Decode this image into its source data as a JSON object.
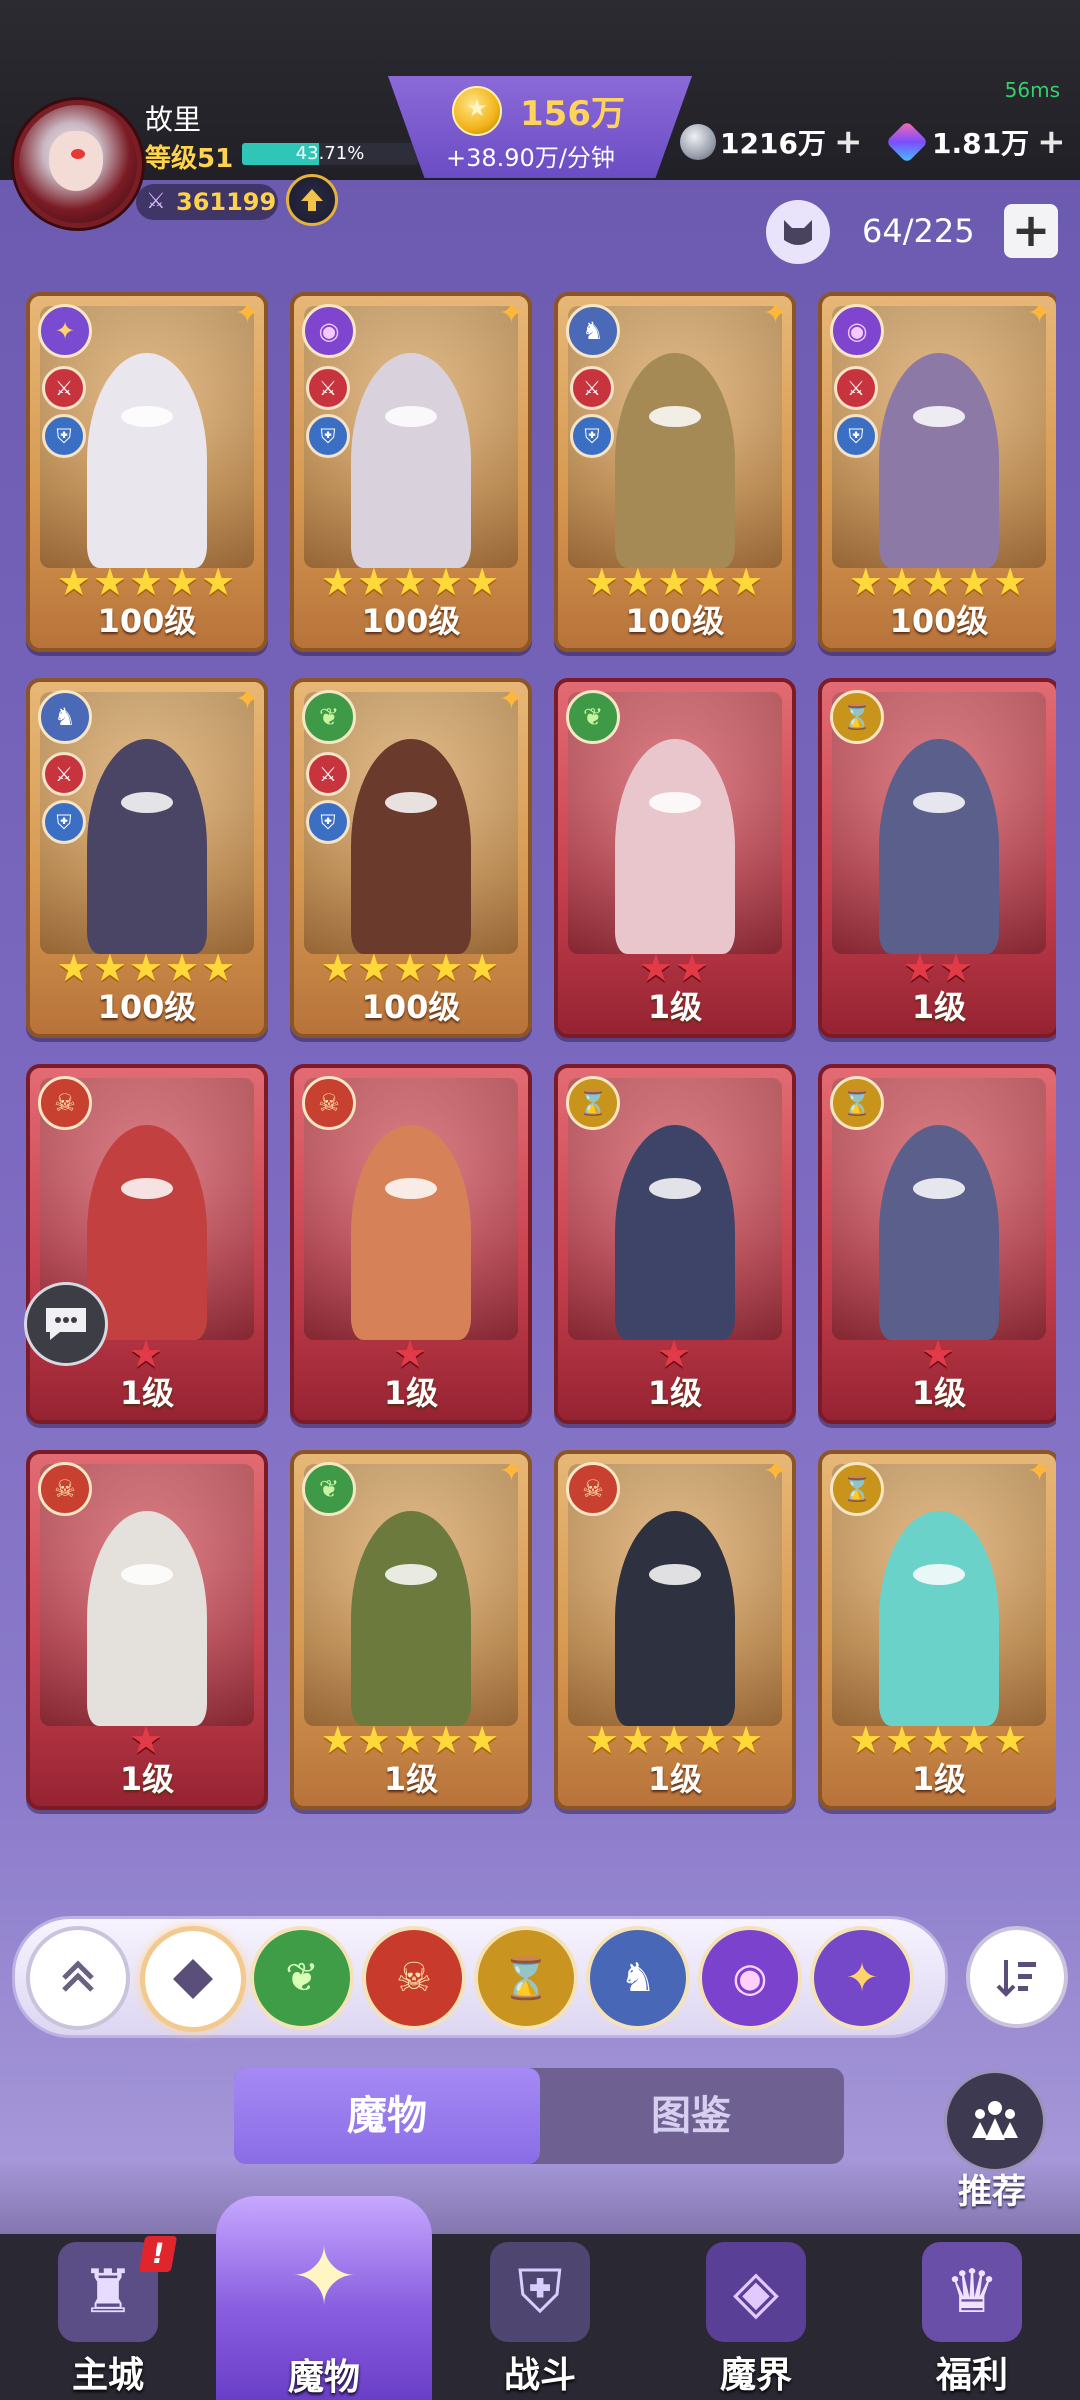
{
  "status": {
    "ping": "56ms"
  },
  "player": {
    "name": "故里",
    "level": "等级51",
    "xp_percent": "43.71%",
    "xp_fraction": 0.4371,
    "power": "361199"
  },
  "gold": {
    "amount": "156万",
    "rate": "+38.90万/分钟"
  },
  "currencies": [
    {
      "icon": "silver-coin-icon",
      "value": "1216万"
    },
    {
      "icon": "gem-icon",
      "value": "1.81万"
    }
  ],
  "collection": {
    "count": "64/225"
  },
  "monsters": [
    {
      "frame": "gold",
      "element": "spirit",
      "roles": true,
      "stars": 5,
      "star_color": "gold",
      "level": "100级",
      "art": "#e9e6ee"
    },
    {
      "frame": "gold",
      "element": "eye",
      "roles": true,
      "stars": 5,
      "star_color": "gold",
      "level": "100级",
      "art": "#d9d2dc"
    },
    {
      "frame": "gold",
      "element": "dragon",
      "roles": true,
      "stars": 5,
      "star_color": "gold",
      "level": "100级",
      "art": "#a58a56"
    },
    {
      "frame": "gold",
      "element": "eye",
      "roles": true,
      "stars": 5,
      "star_color": "gold",
      "level": "100级",
      "art": "#8d79a6"
    },
    {
      "frame": "gold",
      "element": "dragon",
      "roles": true,
      "stars": 5,
      "star_color": "gold",
      "level": "100级",
      "art": "#4b4565"
    },
    {
      "frame": "gold",
      "element": "nature",
      "roles": true,
      "stars": 5,
      "star_color": "gold",
      "level": "100级",
      "art": "#6a3a2d"
    },
    {
      "frame": "red",
      "element": "nature",
      "roles": false,
      "stars": 2,
      "star_color": "red",
      "level": "1级",
      "art": "#e9c6cc"
    },
    {
      "frame": "red",
      "element": "time",
      "roles": false,
      "stars": 2,
      "star_color": "red",
      "level": "1级",
      "art": "#5a5f8c"
    },
    {
      "frame": "red",
      "element": "demon",
      "roles": false,
      "stars": 1,
      "star_color": "red",
      "level": "1级",
      "art": "#c2403f"
    },
    {
      "frame": "red",
      "element": "demon",
      "roles": false,
      "stars": 1,
      "star_color": "red",
      "level": "1级",
      "art": "#d78158"
    },
    {
      "frame": "red",
      "element": "time",
      "roles": false,
      "stars": 1,
      "star_color": "red",
      "level": "1级",
      "art": "#3e4468"
    },
    {
      "frame": "red",
      "element": "time",
      "roles": false,
      "stars": 1,
      "star_color": "red",
      "level": "1级",
      "art": "#5a5f8c"
    },
    {
      "frame": "red",
      "element": "demon",
      "roles": false,
      "stars": 1,
      "star_color": "red",
      "level": "1级",
      "art": "#e4e0dc"
    },
    {
      "frame": "gold",
      "element": "nature",
      "roles": false,
      "stars": 5,
      "star_color": "gold",
      "level": "1级",
      "art": "#6c7a3e"
    },
    {
      "frame": "gold",
      "element": "demon",
      "roles": false,
      "stars": 5,
      "star_color": "gold",
      "level": "1级",
      "art": "#2e3140"
    },
    {
      "frame": "gold",
      "element": "time",
      "roles": false,
      "stars": 5,
      "star_color": "gold",
      "level": "1级",
      "art": "#6ad2c8"
    }
  ],
  "filters": [
    "all",
    "nature",
    "demon",
    "time",
    "dragon",
    "eye",
    "spirit"
  ],
  "tabs": {
    "active": "魔物",
    "inactive": "图鉴"
  },
  "recommend_label": "推荐",
  "nav": [
    {
      "label": "主城",
      "icon": "castle-icon"
    },
    {
      "label": "魔物",
      "icon": "flame-spirit-icon"
    },
    {
      "label": "战斗",
      "icon": "shield-sword-icon"
    },
    {
      "label": "魔界",
      "icon": "portal-icon"
    },
    {
      "label": "福利",
      "icon": "treasure-chest-icon"
    }
  ],
  "nav_alert": "!"
}
